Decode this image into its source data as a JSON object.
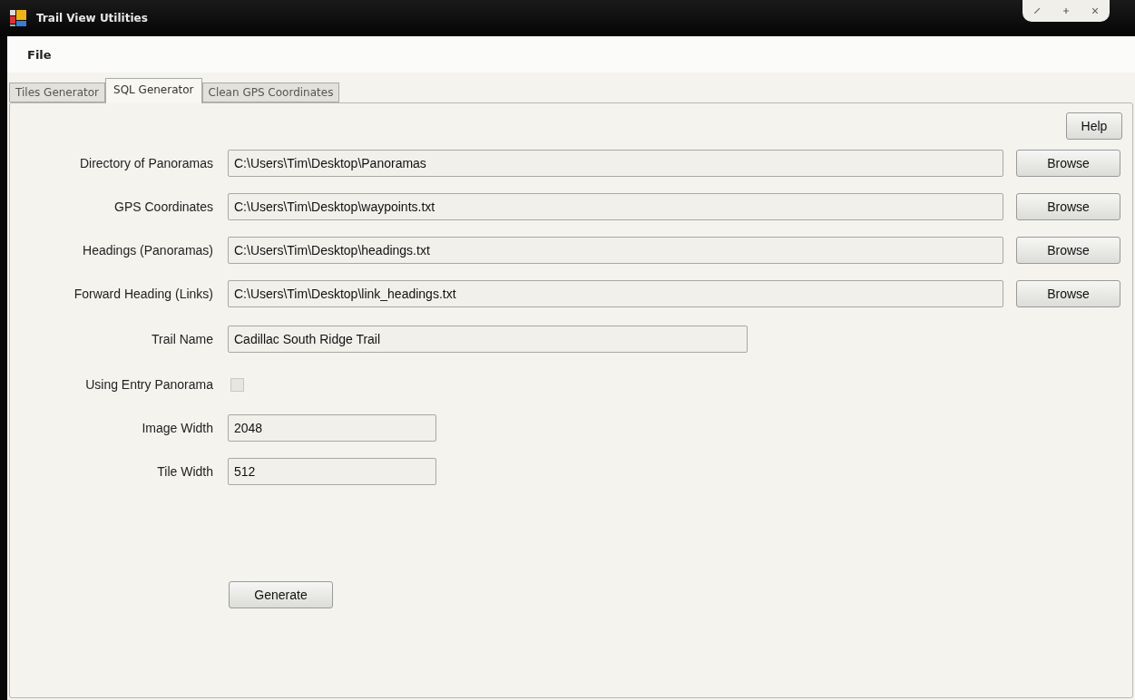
{
  "window": {
    "title": "Trail View Utilities"
  },
  "menu": [
    "File"
  ],
  "tabs": [
    {
      "label": "Tiles Generator",
      "selected": false
    },
    {
      "label": "SQL Generator",
      "selected": true
    },
    {
      "label": "Clean GPS Coordinates",
      "selected": false
    }
  ],
  "help_button": "Help",
  "fields": [
    {
      "kind": "path",
      "label": "Directory of Panoramas",
      "value": "C:\\Users\\Tim\\Desktop\\Panoramas",
      "button": "Browse"
    },
    {
      "kind": "path",
      "label": "GPS Coordinates",
      "value": "C:\\Users\\Tim\\Desktop\\waypoints.txt",
      "button": "Browse"
    },
    {
      "kind": "path",
      "label": "Headings (Panoramas)",
      "value": "C:\\Users\\Tim\\Desktop\\headings.txt",
      "button": "Browse"
    },
    {
      "kind": "path",
      "label": "Forward Heading (Links)",
      "value": "C:\\Users\\Tim\\Desktop\\link_headings.txt",
      "button": "Browse"
    },
    {
      "kind": "name",
      "label": "Trail Name",
      "value": "Cadillac South Ridge Trail"
    },
    {
      "kind": "checkbox",
      "label": "Using Entry Panorama",
      "checked": false,
      "disabled": true
    },
    {
      "kind": "number",
      "label": "Image Width",
      "value": "2048"
    },
    {
      "kind": "number",
      "label": "Tile Width",
      "value": "512"
    }
  ],
  "generate_button": "Generate"
}
